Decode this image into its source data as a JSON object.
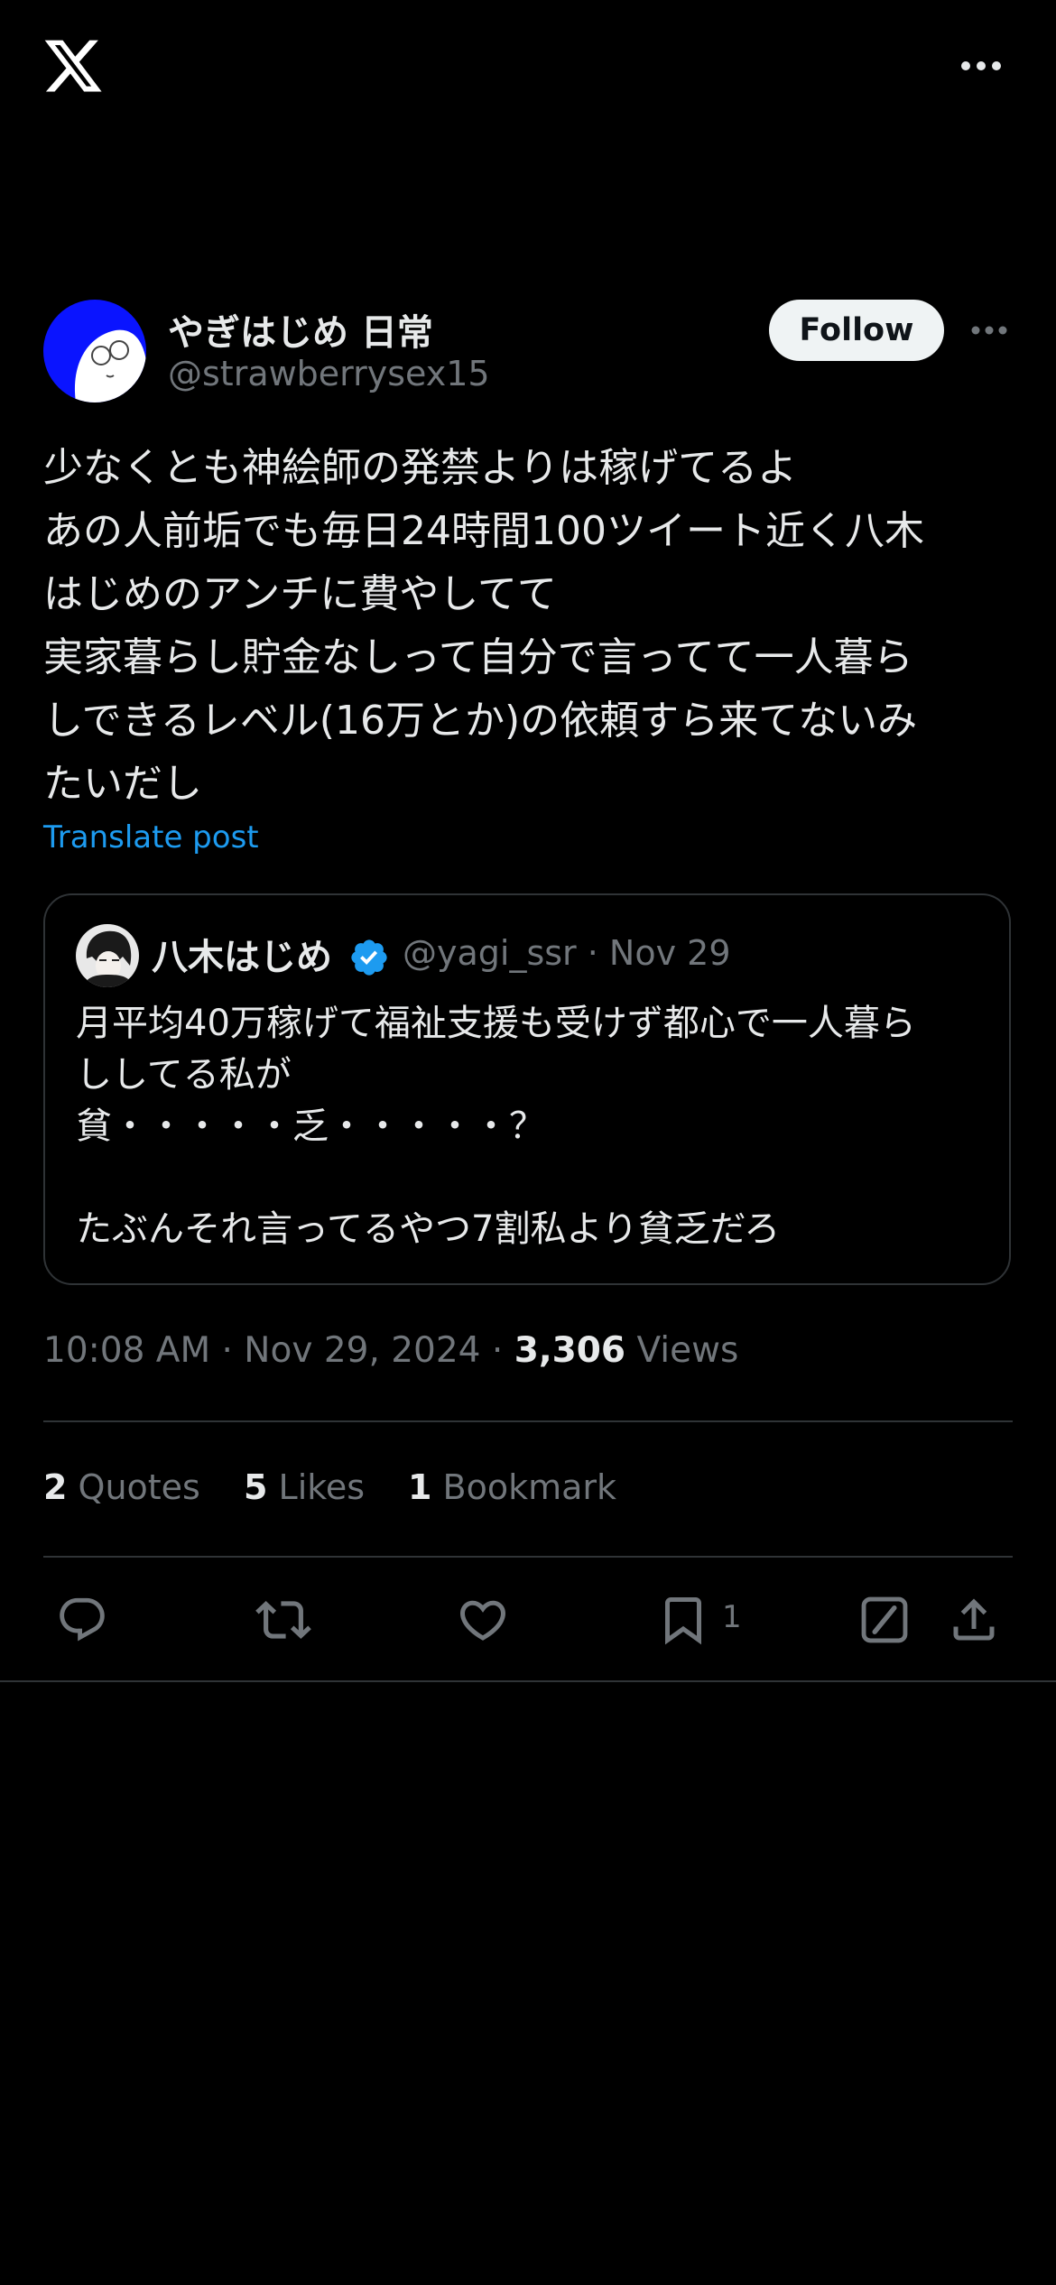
{
  "app": {
    "logo_icon": "x-logo-icon",
    "more_icon": "more-horizontal-icon"
  },
  "author": {
    "name": "やぎはじめ 日常",
    "handle": "@strawberrysex15",
    "follow_label": "Follow",
    "avatar_colors": {
      "background": "#0a14ff",
      "face": "#ffffff"
    }
  },
  "tweet": {
    "text": "少なくとも神絵師の発禁よりは稼げてるよ\nあの人前垢でも毎日24時間100ツイート近く八木\nはじめのアンチに費やしてて\n実家暮らし貯金なしって自分で言ってて一人暮ら\nしできるレベル(16万とか)の依頼すら来てないみ\nたいだし",
    "translate_label": "Translate post"
  },
  "quoted": {
    "name": "八木はじめ",
    "verified_icon": "verified-badge-icon",
    "handle_date": "@yagi_ssr · Nov 29",
    "text": "月平均40万稼げて福祉支援も受けず都心で一人暮ら\nししてる私が\n貧・・・・・乏・・・・・？\n\nたぶんそれ言ってるやつ7割私より貧乏だろ"
  },
  "meta": {
    "time_date": "10:08 AM · Nov 29, 2024 · ",
    "views_count": "3,306",
    "views_label": " Views"
  },
  "stats": [
    {
      "count": "2",
      "label": " Quotes"
    },
    {
      "count": "5",
      "label": " Likes"
    },
    {
      "count": "1",
      "label": " Bookmark"
    }
  ],
  "actions": {
    "reply_icon": "reply-icon",
    "repost_icon": "repost-icon",
    "like_icon": "heart-icon",
    "bookmark_icon": "bookmark-icon",
    "bookmark_count": "1",
    "grok_icon": "grok-icon",
    "share_icon": "share-icon"
  },
  "colors": {
    "background": "#000000",
    "text": "#e7e9ea",
    "secondary": "#71767b",
    "accent": "#1d9bf0",
    "border": "#2f3336"
  }
}
